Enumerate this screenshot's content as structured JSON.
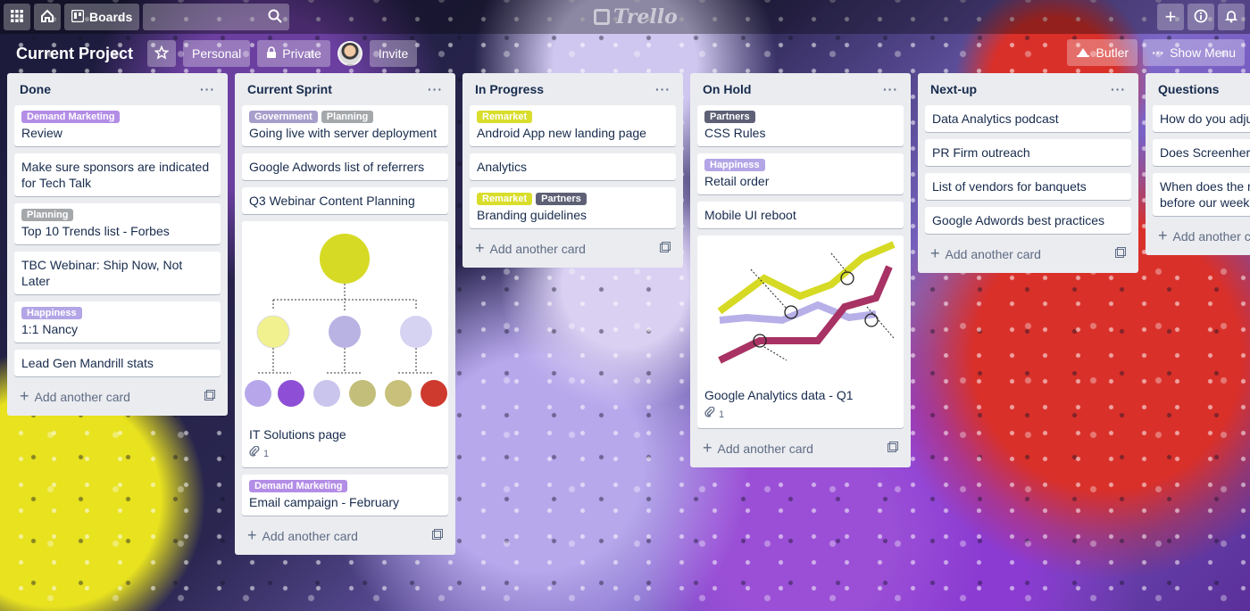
{
  "topbar": {
    "boards_label": "Boards",
    "logo_text": "Trello"
  },
  "board": {
    "title": "Current Project",
    "visibility_team": "Personal",
    "visibility": "Private",
    "invite_label": "Invite",
    "butler_label": "Butler",
    "show_menu_label": "Show Menu"
  },
  "colors": {
    "purple_label": "#a583e0",
    "gray_label": "#a5a8ab",
    "yellow_label": "#d9dd2b",
    "dark_label": "#6b6f80"
  },
  "add_card_label": "Add another card",
  "lists": [
    {
      "title": "Done",
      "cards": [
        {
          "labels": [
            {
              "text": "Demand Marketing",
              "color": "#b38de6"
            }
          ],
          "text": "Review"
        },
        {
          "labels": [],
          "text": "Make sure sponsors are indicated for Tech Talk"
        },
        {
          "labels": [
            {
              "text": "Planning",
              "color": "#a5a8ab"
            }
          ],
          "text": "Top 10 Trends list - Forbes"
        },
        {
          "labels": [],
          "text": "TBC Webinar: Ship Now, Not Later"
        },
        {
          "labels": [
            {
              "text": "Happiness",
              "color": "#b3a5e6"
            }
          ],
          "text": "1:1 Nancy"
        },
        {
          "labels": [],
          "text": "Lead Gen Mandrill stats"
        }
      ]
    },
    {
      "title": "Current Sprint",
      "cards": [
        {
          "labels": [
            {
              "text": "Government",
              "color": "#a79ecb"
            },
            {
              "text": "Planning",
              "color": "#a5a8ab"
            }
          ],
          "text": "Going live with server deployment"
        },
        {
          "labels": [],
          "text": "Google Adwords list of referrers"
        },
        {
          "labels": [],
          "text": "Q3 Webinar Content Planning"
        },
        {
          "labels": [],
          "text": "IT Solutions page",
          "attachments": "1"
        },
        {
          "labels": [
            {
              "text": "Demand Marketing",
              "color": "#b38de6"
            }
          ],
          "text": "Email campaign - February"
        }
      ]
    },
    {
      "title": "In Progress",
      "cards": [
        {
          "labels": [
            {
              "text": "Remarket",
              "color": "#d9dd2b"
            }
          ],
          "text": "Android App new landing page"
        },
        {
          "labels": [],
          "text": "Analytics"
        },
        {
          "labels": [
            {
              "text": "Remarket",
              "color": "#d9dd2b"
            },
            {
              "text": "Partners",
              "color": "#5e6075"
            }
          ],
          "text": "Branding guidelines"
        }
      ]
    },
    {
      "title": "On Hold",
      "cards": [
        {
          "labels": [
            {
              "text": "Partners",
              "color": "#5e6075"
            }
          ],
          "text": "CSS Rules"
        },
        {
          "labels": [
            {
              "text": "Happiness",
              "color": "#b3a5e6"
            }
          ],
          "text": "Retail order"
        },
        {
          "labels": [],
          "text": "Mobile UI reboot"
        },
        {
          "labels": [],
          "text": "Google Analytics data - Q1",
          "attachments": "1"
        }
      ]
    },
    {
      "title": "Next-up",
      "cards": [
        {
          "labels": [],
          "text": "Data Analytics podcast"
        },
        {
          "labels": [],
          "text": "PR Firm outreach"
        },
        {
          "labels": [],
          "text": "List of vendors for banquets"
        },
        {
          "labels": [],
          "text": "Google Adwords best practices"
        }
      ]
    },
    {
      "title": "Questions",
      "cards": [
        {
          "labels": [],
          "text": "How do you adjust Illustrator?"
        },
        {
          "labels": [],
          "text": "Does Screenhero"
        },
        {
          "labels": [],
          "text": "When does the new increase - before our week?"
        }
      ]
    }
  ]
}
